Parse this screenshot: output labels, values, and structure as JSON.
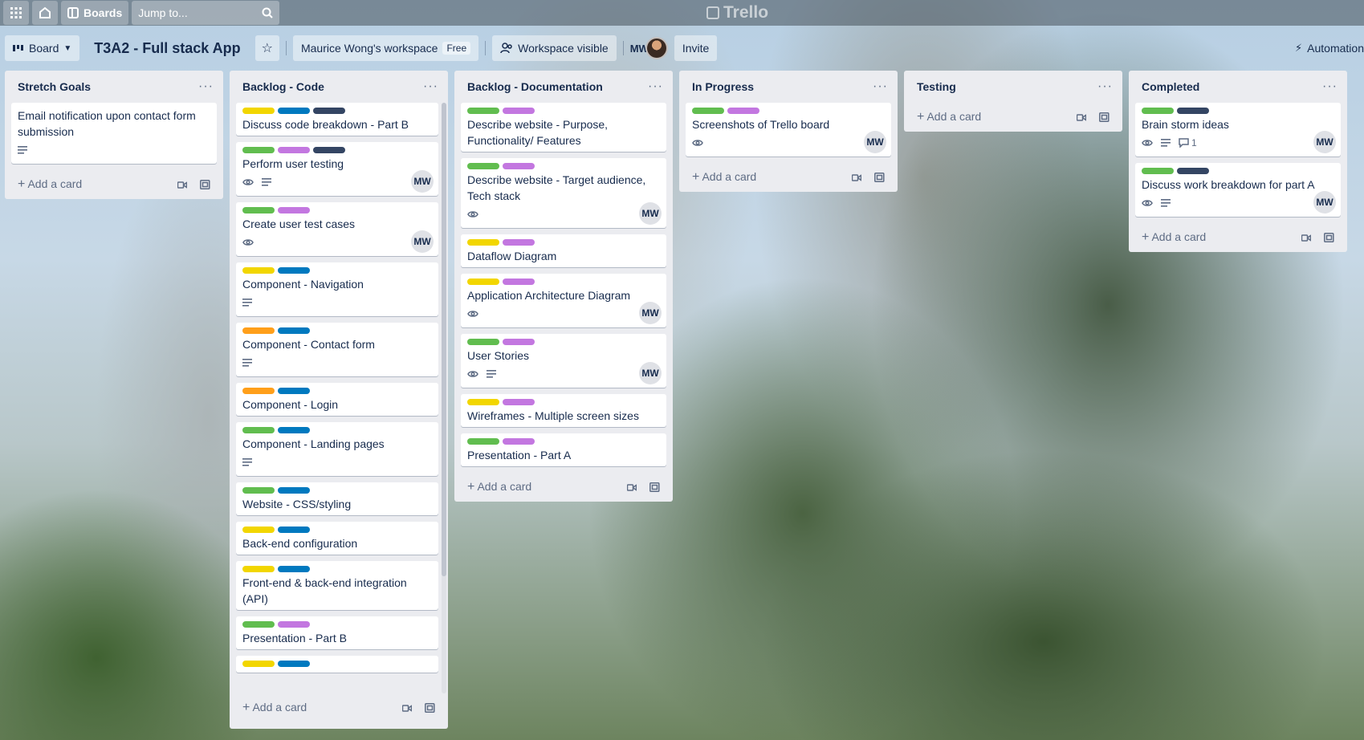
{
  "topnav": {
    "boards_label": "Boards",
    "search_placeholder": "Jump to...",
    "logo_text": "Trello"
  },
  "boardbar": {
    "view_label": "Board",
    "title": "T3A2 - Full stack App",
    "workspace": "Maurice Wong's workspace",
    "plan_badge": "Free",
    "visibility": "Workspace visible",
    "member_initials": "MW",
    "invite_label": "Invite",
    "automation_label": "Automation"
  },
  "colors": {
    "green": "#61bd4f",
    "purple": "#c377e0",
    "yellow": "#f2d600",
    "blue": "#0079bf",
    "navy": "#344563",
    "orange": "#ff9f1a"
  },
  "add_card_label": "Add a card",
  "lists": [
    {
      "title": "Stretch Goals",
      "cards": [
        {
          "title": "Email notification upon contact form submission",
          "labels": [],
          "badges": [
            "description"
          ],
          "member": ""
        }
      ]
    },
    {
      "title": "Backlog - Code",
      "cards": [
        {
          "title": "Discuss code breakdown - Part B",
          "labels": [
            "yellow",
            "blue",
            "navy"
          ],
          "badges": [],
          "member": ""
        },
        {
          "title": "Perform user testing",
          "labels": [
            "green",
            "purple",
            "navy"
          ],
          "badges": [
            "watch",
            "description"
          ],
          "member": "MW"
        },
        {
          "title": "Create user test cases",
          "labels": [
            "green",
            "purple"
          ],
          "badges": [
            "watch"
          ],
          "member": "MW"
        },
        {
          "title": "Component - Navigation",
          "labels": [
            "yellow",
            "blue"
          ],
          "badges": [
            "description"
          ],
          "member": ""
        },
        {
          "title": "Component - Contact form",
          "labels": [
            "orange",
            "blue"
          ],
          "badges": [
            "description"
          ],
          "member": ""
        },
        {
          "title": "Component - Login",
          "labels": [
            "orange",
            "blue"
          ],
          "badges": [],
          "member": ""
        },
        {
          "title": "Component - Landing pages",
          "labels": [
            "green",
            "blue"
          ],
          "badges": [
            "description"
          ],
          "member": ""
        },
        {
          "title": "Website - CSS/styling",
          "labels": [
            "green",
            "blue"
          ],
          "badges": [],
          "member": ""
        },
        {
          "title": "Back-end configuration",
          "labels": [
            "yellow",
            "blue"
          ],
          "badges": [],
          "member": ""
        },
        {
          "title": "Front-end & back-end integration (API)",
          "labels": [
            "yellow",
            "blue"
          ],
          "badges": [],
          "member": ""
        },
        {
          "title": "Presentation - Part B",
          "labels": [
            "green",
            "purple"
          ],
          "badges": [],
          "member": ""
        },
        {
          "title": "",
          "labels": [
            "yellow",
            "blue"
          ],
          "badges": [],
          "member": ""
        }
      ]
    },
    {
      "title": "Backlog - Documentation",
      "cards": [
        {
          "title": "Describe website - Purpose, Functionality/ Features",
          "labels": [
            "green",
            "purple"
          ],
          "badges": [],
          "member": ""
        },
        {
          "title": "Describe website - Target audience, Tech stack",
          "labels": [
            "green",
            "purple"
          ],
          "badges": [
            "watch"
          ],
          "member": "MW"
        },
        {
          "title": "Dataflow Diagram",
          "labels": [
            "yellow",
            "purple"
          ],
          "badges": [],
          "member": ""
        },
        {
          "title": "Application Architecture Diagram",
          "labels": [
            "yellow",
            "purple"
          ],
          "badges": [
            "watch"
          ],
          "member": "MW"
        },
        {
          "title": "User Stories",
          "labels": [
            "green",
            "purple"
          ],
          "badges": [
            "watch",
            "description"
          ],
          "member": "MW"
        },
        {
          "title": "Wireframes - Multiple screen sizes",
          "labels": [
            "yellow",
            "purple"
          ],
          "badges": [],
          "member": ""
        },
        {
          "title": "Presentation - Part A",
          "labels": [
            "green",
            "purple"
          ],
          "badges": [],
          "member": ""
        }
      ]
    },
    {
      "title": "In Progress",
      "cards": [
        {
          "title": "Screenshots of Trello board",
          "labels": [
            "green",
            "purple"
          ],
          "badges": [
            "watch"
          ],
          "member": "MW"
        }
      ]
    },
    {
      "title": "Testing",
      "cards": []
    },
    {
      "title": "Completed",
      "cards": [
        {
          "title": "Brain storm ideas",
          "labels": [
            "green",
            "navy"
          ],
          "badges": [
            "watch",
            "description",
            "comments"
          ],
          "comments": "1",
          "member": "MW"
        },
        {
          "title": "Discuss work breakdown for part A",
          "labels": [
            "green",
            "navy"
          ],
          "badges": [
            "watch",
            "description"
          ],
          "member": "MW"
        }
      ]
    }
  ]
}
